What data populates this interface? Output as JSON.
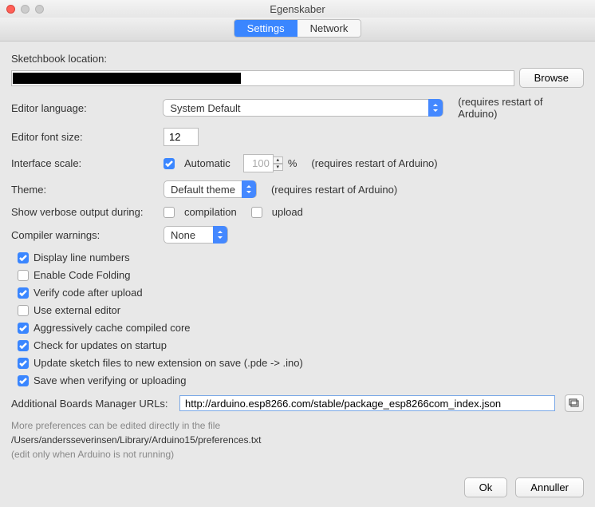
{
  "window": {
    "title": "Egenskaber"
  },
  "tabs": {
    "settings": "Settings",
    "network": "Network"
  },
  "labels": {
    "sketchbook": "Sketchbook location:",
    "editor_lang": "Editor language:",
    "editor_font": "Editor font size:",
    "iface_scale": "Interface scale:",
    "theme": "Theme:",
    "verbose": "Show verbose output during:",
    "compiler_warn": "Compiler warnings:",
    "additional_urls": "Additional Boards Manager URLs:"
  },
  "values": {
    "sketchbook_path": "",
    "editor_lang": "System Default",
    "editor_font": "12",
    "iface_scale": "100",
    "theme": "Default theme",
    "compiler_warn": "None",
    "additional_urls": "http://arduino.esp8266.com/stable/package_esp8266com_index.json"
  },
  "hints": {
    "restart": "(requires restart of Arduino)",
    "percent": "%"
  },
  "inline": {
    "auto": "Automatic",
    "compilation": "compilation",
    "upload": "upload"
  },
  "checkboxes": [
    {
      "label": "Display line numbers",
      "checked": true
    },
    {
      "label": "Enable Code Folding",
      "checked": false
    },
    {
      "label": "Verify code after upload",
      "checked": true
    },
    {
      "label": "Use external editor",
      "checked": false
    },
    {
      "label": "Aggressively cache compiled core",
      "checked": true
    },
    {
      "label": "Check for updates on startup",
      "checked": true
    },
    {
      "label": "Update sketch files to new extension on save (.pde -> .ino)",
      "checked": true
    },
    {
      "label": "Save when verifying or uploading",
      "checked": true
    }
  ],
  "footer": {
    "l1": "More preferences can be edited directly in the file",
    "l2": "/Users/andersseverinsen/Library/Arduino15/preferences.txt",
    "l3": "(edit only when Arduino is not running)"
  },
  "buttons": {
    "browse": "Browse",
    "ok": "Ok",
    "cancel": "Annuller"
  }
}
